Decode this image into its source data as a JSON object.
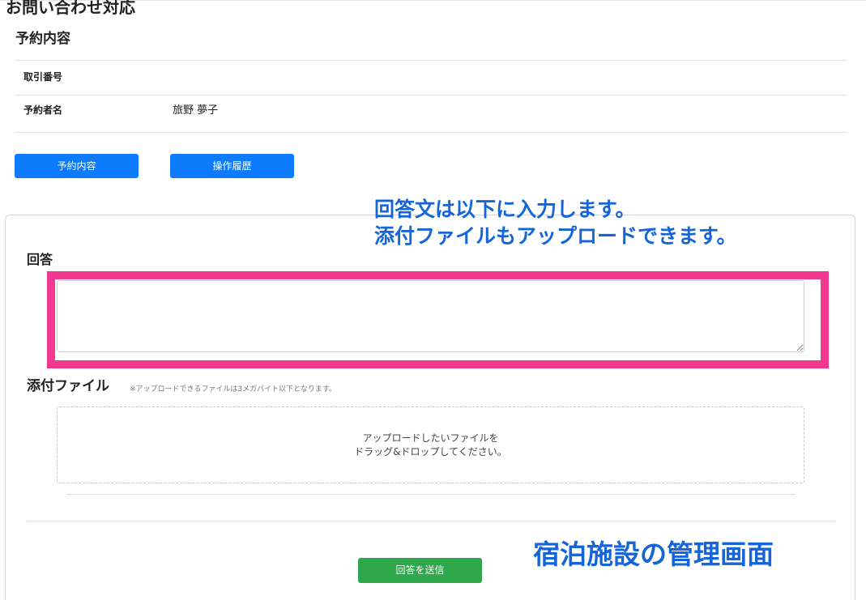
{
  "page": {
    "title": "お問い合わせ対応"
  },
  "reservation": {
    "section_title": "予約内容",
    "rows": [
      {
        "label": "取引番号",
        "value": ""
      },
      {
        "label": "予約者名",
        "value": "旅野 夢子"
      }
    ]
  },
  "buttons": {
    "reservation_details": "予約内容",
    "operation_history": "操作履歴",
    "submit_answer": "回答を送信"
  },
  "answer": {
    "label": "回答",
    "value": "",
    "callout_line1": "回答文は以下に入力します。",
    "callout_line2": "添付ファイルもアップロードできます。"
  },
  "attachment": {
    "label": "添付ファイル",
    "note": "※アップロードできるファイルは3メガバイト以下となります。",
    "dropzone_line1": "アップロードしたいファイルを",
    "dropzone_line2": "ドラッグ&ドロップしてください。"
  },
  "caption": "宿泊施設の管理画面",
  "colors": {
    "primary_blue": "#0d7bfc",
    "success_green": "#2ea84a",
    "highlight_pink": "#f2398f",
    "annotation_blue": "#1565d8"
  }
}
